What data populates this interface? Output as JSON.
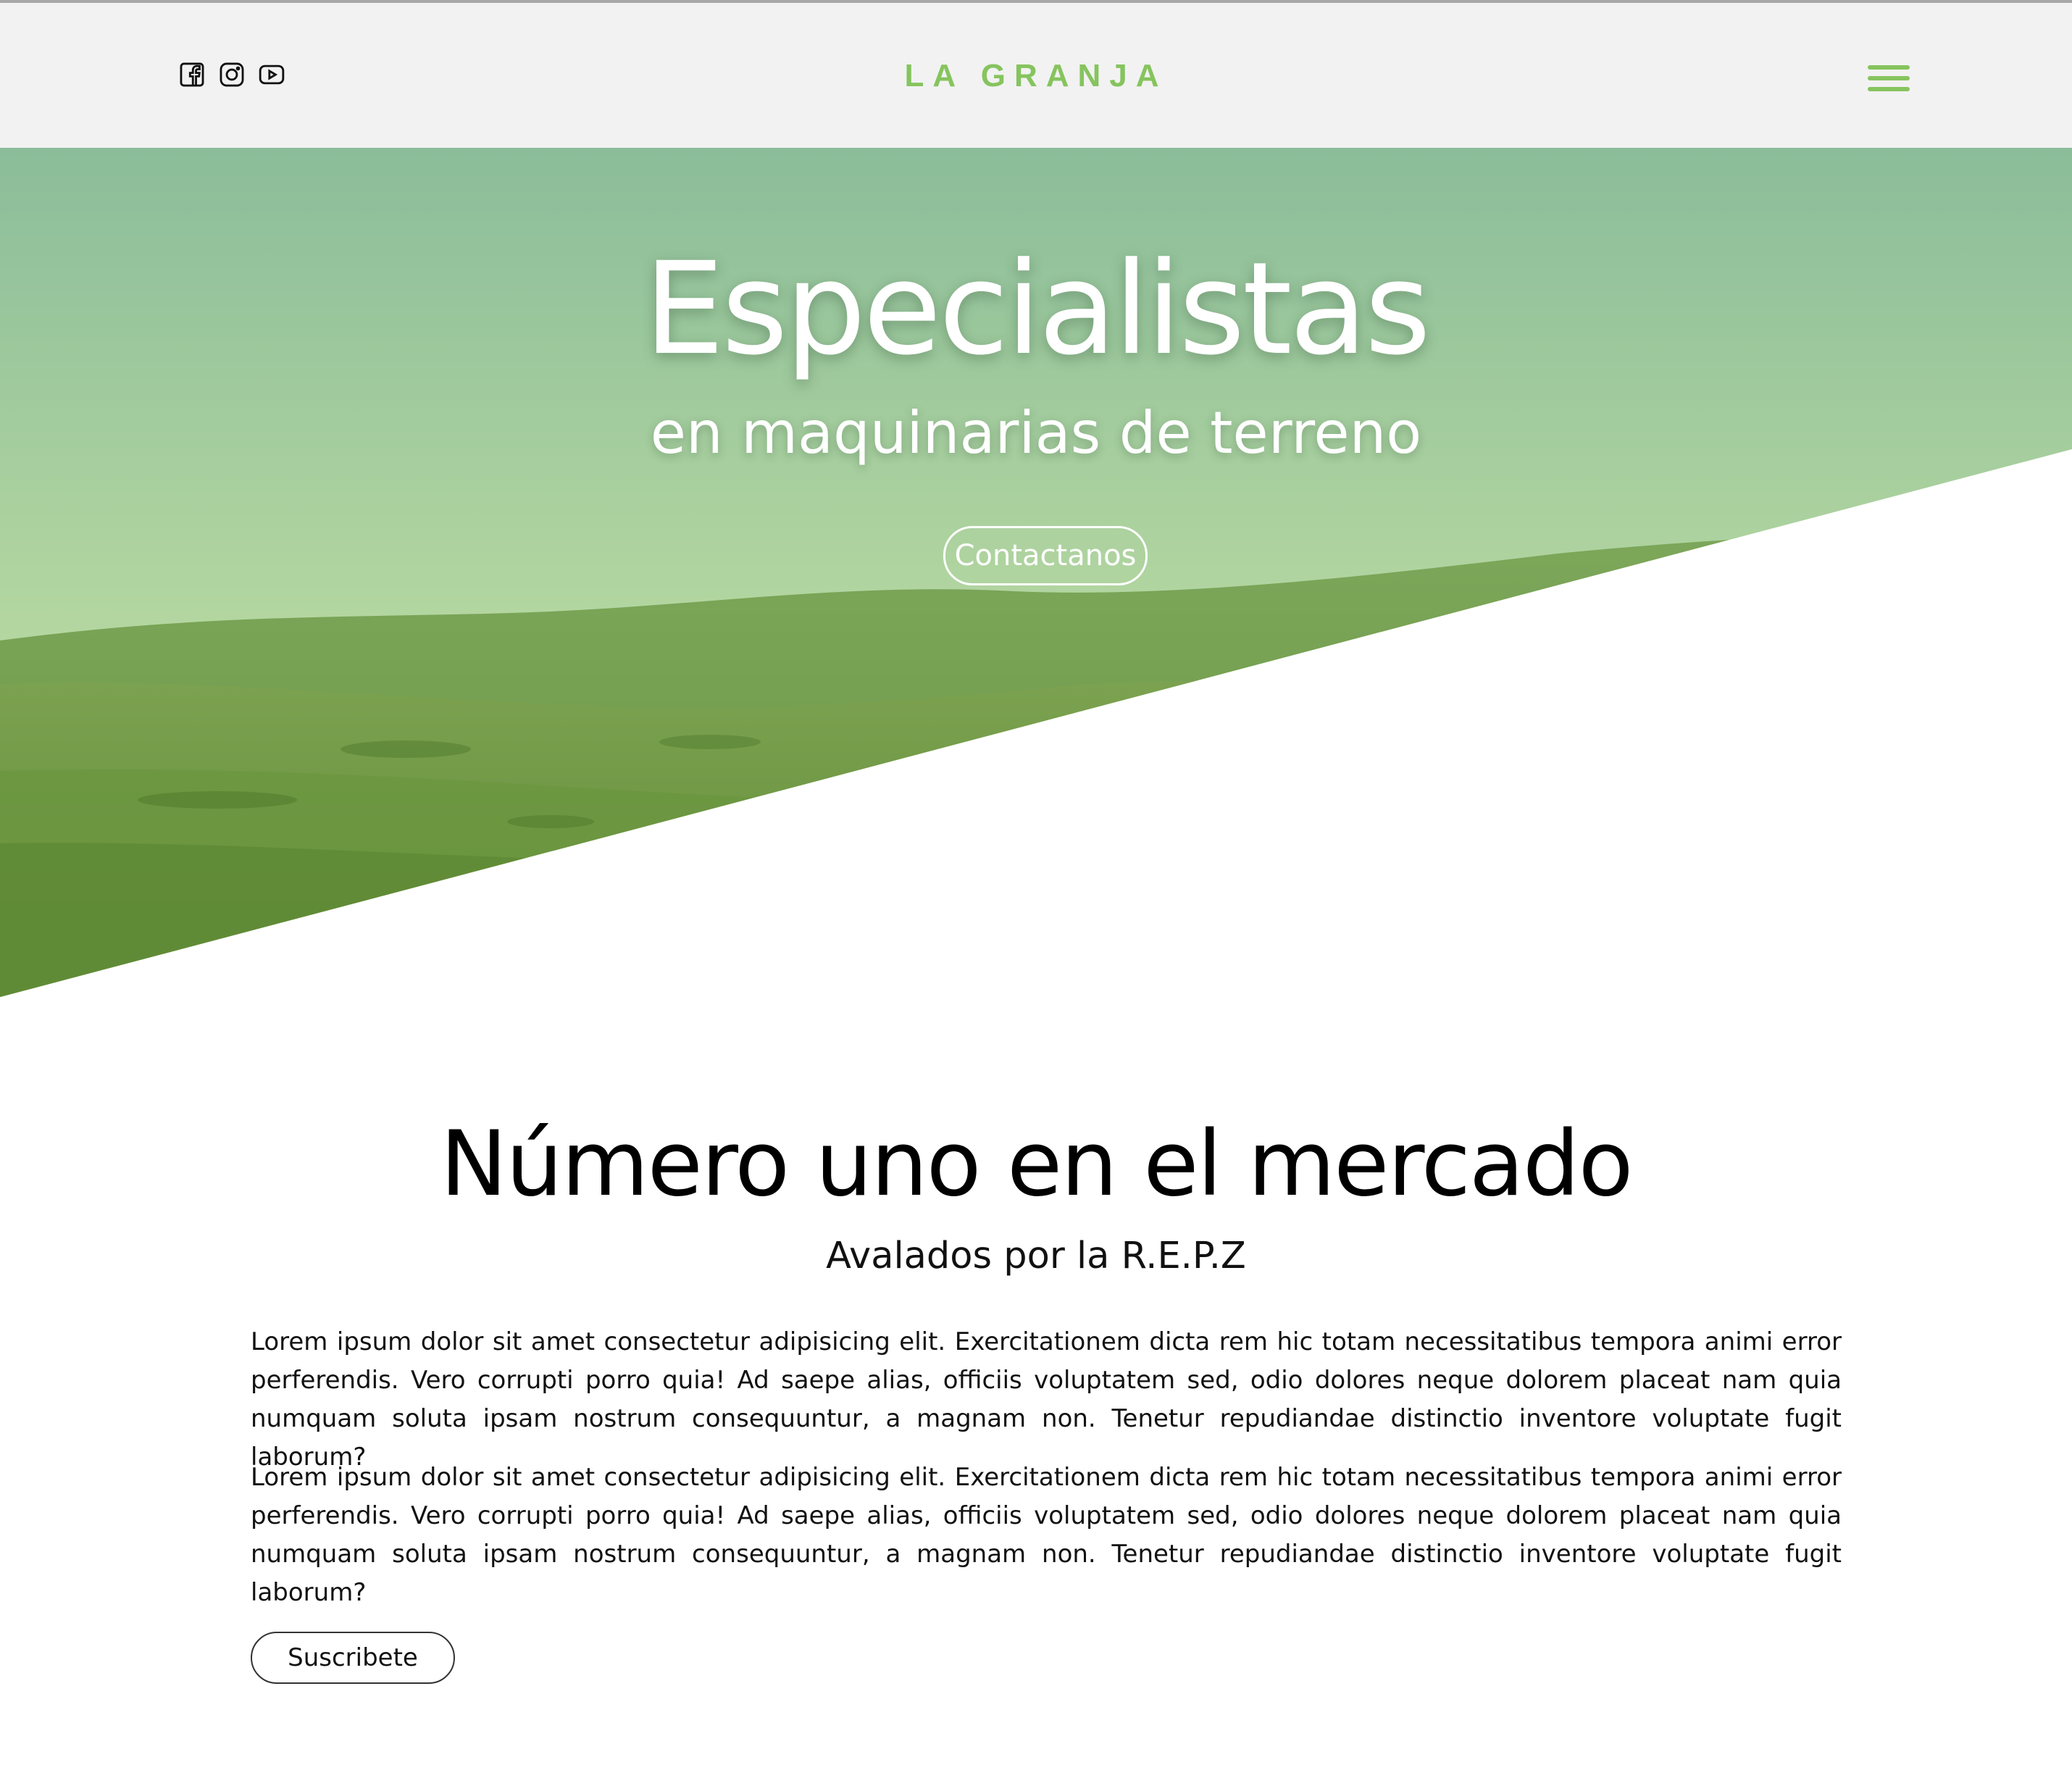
{
  "navbar": {
    "logo": "LA GRANJA",
    "social": [
      "facebook-icon",
      "instagram-icon",
      "youtube-icon"
    ],
    "menu_icon": "hamburger-menu-icon"
  },
  "hero": {
    "title": "Especialistas",
    "subtitle": "en maquinarias de terreno",
    "cta_label": "Contactanos"
  },
  "content": {
    "title": "Número uno en el mercado",
    "subtitle": "Avalados por la R.E.P.Z",
    "paragraphs": [
      "Lorem ipsum dolor sit amet consectetur adipisicing elit. Exercitationem dicta rem hic totam necessitatibus tempora animi error perferendis. Vero corrupti porro quia! Ad saepe alias, officiis voluptatem sed, odio dolores neque dolorem placeat nam quia numquam soluta ipsam nostrum consequuntur, a magnam non. Tenetur repudiandae distinctio inventore voluptate fugit laborum?",
      "Lorem ipsum dolor sit amet consectetur adipisicing elit. Exercitationem dicta rem hic totam necessitatibus tempora animi error perferendis. Vero corrupti porro quia! Ad saepe alias, officiis voluptatem sed, odio dolores neque dolorem placeat nam quia numquam soluta ipsam nostrum consequuntur, a magnam non. Tenetur repudiandae distinctio inventore voluptate fugit laborum?"
    ],
    "button_label": "Suscribete"
  },
  "colors": {
    "accent": "#86c45e",
    "navbar_bg": "#f2f2f2",
    "hero_overlay_top": "#8bbd9a",
    "hero_overlay_bottom": "#b8d8a0",
    "hills": "#6e9a44",
    "text": "#000000"
  }
}
